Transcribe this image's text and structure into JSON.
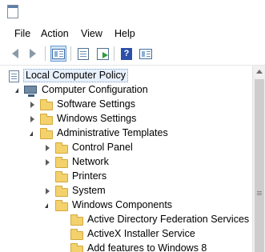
{
  "window": {
    "app_icon": "policy-editor-icon"
  },
  "menu": [
    "File",
    "Action",
    "View",
    "Help"
  ],
  "toolbar": {
    "buttons": [
      {
        "name": "back-button",
        "icon": "arrow-left-icon"
      },
      {
        "name": "forward-button",
        "icon": "arrow-right-icon"
      },
      {
        "name": "show-hide-console-tree-button",
        "icon": "console-tree-icon",
        "active": true
      },
      {
        "name": "properties-button",
        "icon": "document-icon"
      },
      {
        "name": "export-list-button",
        "icon": "export-icon"
      },
      {
        "name": "help-button",
        "icon": "help-icon",
        "glyph": "?"
      },
      {
        "name": "show-hide-action-pane-button",
        "icon": "action-pane-icon"
      }
    ]
  },
  "tree": {
    "selected": "Local Computer Policy",
    "items": [
      {
        "label": "Local Computer Policy",
        "icon": "policy-icon",
        "level": 0,
        "expander": "none",
        "selected": true
      },
      {
        "label": "Computer Configuration",
        "icon": "computer-icon",
        "level": 1,
        "expander": "open"
      },
      {
        "label": "Software Settings",
        "icon": "folder-icon",
        "level": 2,
        "expander": "closed"
      },
      {
        "label": "Windows Settings",
        "icon": "folder-icon",
        "level": 2,
        "expander": "closed"
      },
      {
        "label": "Administrative Templates",
        "icon": "folder-icon",
        "level": 2,
        "expander": "open"
      },
      {
        "label": "Control Panel",
        "icon": "folder-icon",
        "level": 3,
        "expander": "closed"
      },
      {
        "label": "Network",
        "icon": "folder-icon",
        "level": 3,
        "expander": "closed"
      },
      {
        "label": "Printers",
        "icon": "folder-icon",
        "level": 3,
        "expander": "none"
      },
      {
        "label": "System",
        "icon": "folder-icon",
        "level": 3,
        "expander": "closed"
      },
      {
        "label": "Windows Components",
        "icon": "folder-icon",
        "level": 3,
        "expander": "open"
      },
      {
        "label": "Active Directory Federation Services",
        "icon": "folder-icon",
        "level": 4,
        "expander": "none"
      },
      {
        "label": "ActiveX Installer Service",
        "icon": "folder-icon",
        "level": 4,
        "expander": "none"
      },
      {
        "label": "Add features to Windows 8",
        "icon": "folder-icon",
        "level": 4,
        "expander": "none"
      }
    ]
  },
  "colors": {
    "folder": "#f3d16c",
    "selection": "#e8f0fb",
    "accent": "#2c4fa8"
  }
}
